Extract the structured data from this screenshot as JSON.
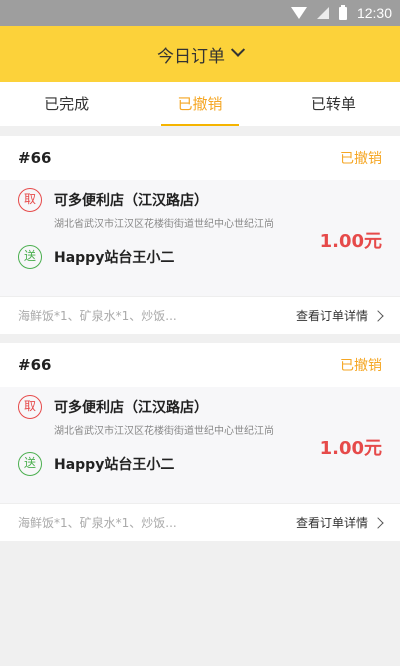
{
  "status_bar": {
    "time": "12:30"
  },
  "header": {
    "title": "今日订单"
  },
  "tabs": [
    {
      "label": "已完成"
    },
    {
      "label": "已撤销"
    },
    {
      "label": "已转单"
    }
  ],
  "orders": [
    {
      "number": "#66",
      "status": "已撤销",
      "pickup_badge": "取",
      "shop": "可多便利店（江汉路店）",
      "address": "湖北省武汉市江汉区花楼街街道世纪中心世纪江尚",
      "deliver_badge": "送",
      "receiver": "Happy站台王小二",
      "price": "1.00元",
      "items": "海鲜饭*1、矿泉水*1、炒饭...",
      "detail_label": "查看订单详情"
    },
    {
      "number": "#66",
      "status": "已撤销",
      "pickup_badge": "取",
      "shop": "可多便利店（江汉路店）",
      "address": "湖北省武汉市江汉区花楼街街道世纪中心世纪江尚",
      "deliver_badge": "送",
      "receiver": "Happy站台王小二",
      "price": "1.00元",
      "items": "海鲜饭*1、矿泉水*1、炒饭...",
      "detail_label": "查看订单详情"
    }
  ]
}
